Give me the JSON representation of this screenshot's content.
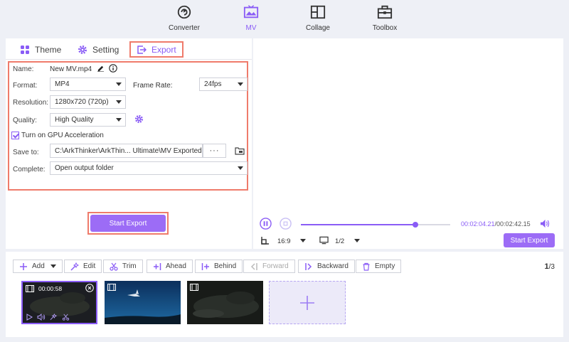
{
  "nav": {
    "items": [
      {
        "label": "Converter",
        "icon": "converter-icon"
      },
      {
        "label": "MV",
        "icon": "mv-icon"
      },
      {
        "label": "Collage",
        "icon": "collage-icon"
      },
      {
        "label": "Toolbox",
        "icon": "toolbox-icon"
      }
    ],
    "active": "MV"
  },
  "tabs": [
    {
      "label": "Theme",
      "icon": "theme-icon"
    },
    {
      "label": "Setting",
      "icon": "gear-icon"
    },
    {
      "label": "Export",
      "icon": "export-icon"
    }
  ],
  "export_settings": {
    "name_label": "Name:",
    "name_value": "New MV.mp4",
    "format_label": "Format:",
    "format_value": "MP4",
    "frame_rate_label": "Frame Rate:",
    "frame_rate_value": "24fps",
    "resolution_label": "Resolution:",
    "resolution_value": "1280x720 (720p)",
    "quality_label": "Quality:",
    "quality_value": "High Quality",
    "gpu_label": "Turn on GPU Acceleration",
    "gpu_checked": true,
    "save_to_label": "Save to:",
    "save_to_value": "C:\\ArkThinker\\ArkThin... Ultimate\\MV Exported",
    "browse_label": "···",
    "complete_label": "Complete:",
    "complete_value": "Open output folder",
    "start_export_label": "Start Export"
  },
  "player": {
    "current_time": "00:02:04.21",
    "total_time": "/00:02:42.15",
    "progress": 0.768,
    "aspect_ratio": "16:9",
    "screen_count": "1/2",
    "start_export_label": "Start Export"
  },
  "toolbar": {
    "add": "Add",
    "edit": "Edit",
    "trim": "Trim",
    "ahead": "Ahead",
    "behind": "Behind",
    "forward": "Forward",
    "backward": "Backward",
    "empty": "Empty",
    "page_current": "1",
    "page_total": "/3"
  },
  "clips": {
    "first_duration": "00:00:58"
  },
  "colors": {
    "accent": "#8a5cf6",
    "button": "#9c6cf6",
    "highlight_border": "#ef7b6b",
    "background": "#eef0f6"
  }
}
